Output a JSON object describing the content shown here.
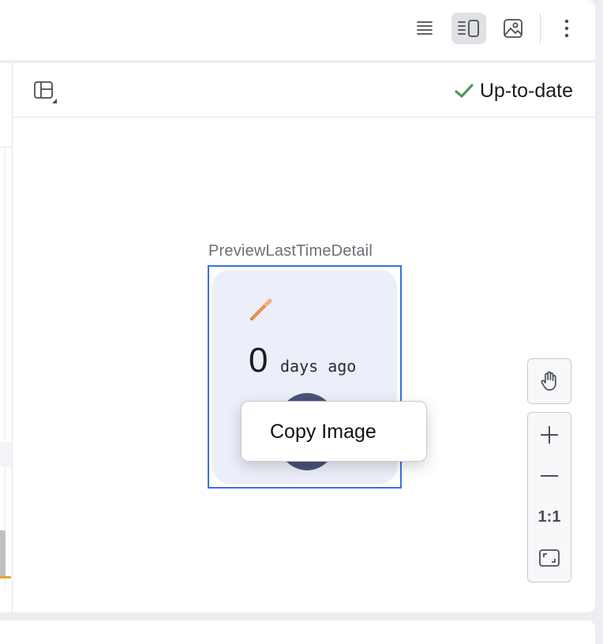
{
  "toolbar": {
    "buttons": [
      {
        "name": "code-view-icon",
        "active": false
      },
      {
        "name": "split-view-icon",
        "active": true
      },
      {
        "name": "design-view-icon",
        "active": false
      },
      {
        "name": "more-options-icon",
        "active": false
      }
    ]
  },
  "preview_header": {
    "layout_icon": "layout-panels-icon",
    "status_icon": "checkmark-icon",
    "status_text": "Up-to-date",
    "status_color": "#4e9a5c"
  },
  "preview": {
    "label": "PreviewLastTimeDetail",
    "frame_color": "#3c6fe0",
    "card": {
      "icon": "toothbrush-icon",
      "count": "0",
      "unit": "days ago",
      "circle_color": "#4a5379"
    }
  },
  "context_menu": {
    "items": [
      {
        "label": "Copy Image"
      }
    ]
  },
  "zoom_controls": {
    "pan_icon": "hand-pan-icon",
    "zoom_in_icon": "plus-icon",
    "zoom_out_icon": "minus-icon",
    "actual_size_label": "1:1",
    "fit_icon": "fit-screen-icon"
  }
}
